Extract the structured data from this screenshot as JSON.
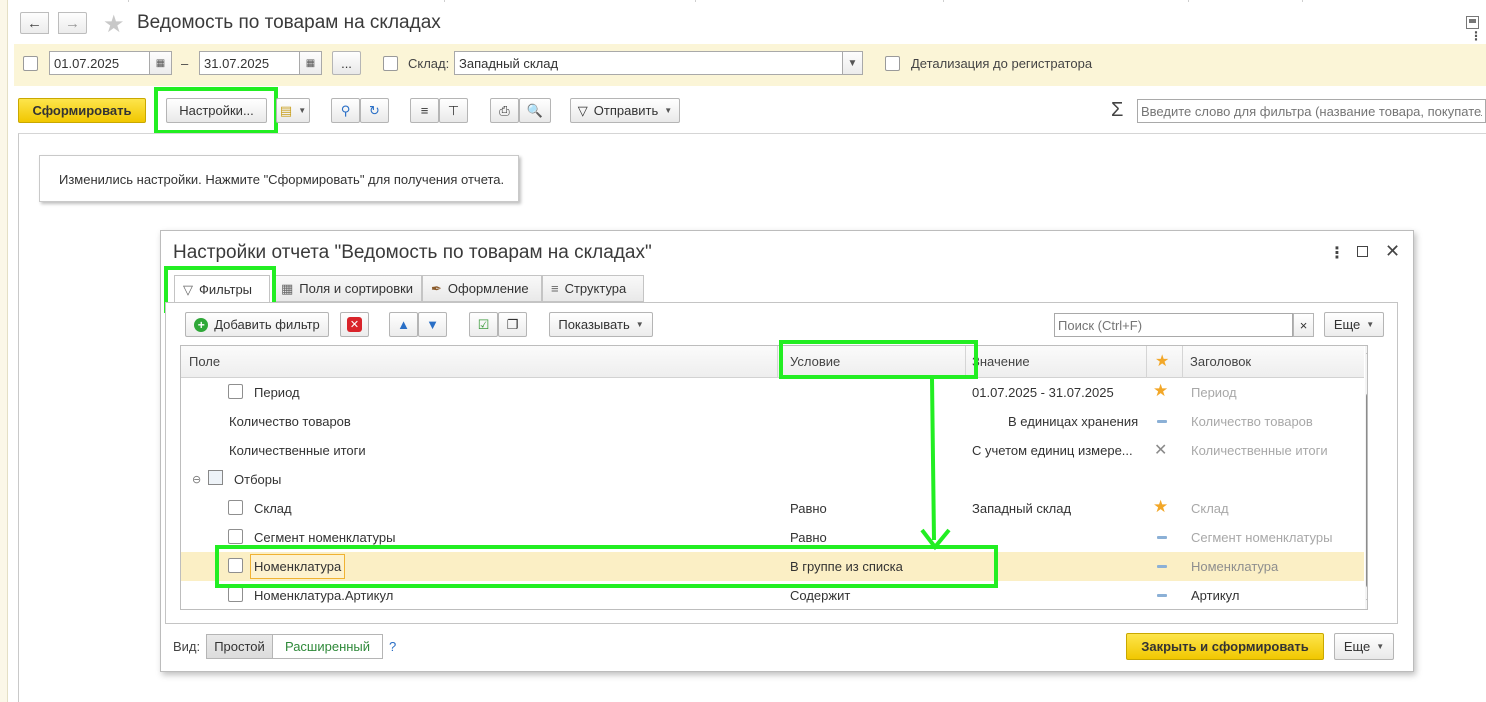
{
  "window": {
    "title": "Ведомость по товарам на складах",
    "back_icon": "arrow-left-icon",
    "forward_icon": "arrow-right-icon",
    "favorite_icon": "star-icon"
  },
  "params": {
    "date_from": "01.07.2025",
    "date_to": "31.07.2025",
    "date_dash": "–",
    "ellipsis_label": "...",
    "warehouse_label": "Склад:",
    "warehouse_value": "Западный склад",
    "detail_label": "Детализация до регистратора"
  },
  "toolbar": {
    "generate_label": "Сформировать",
    "settings_label": "Настройки...",
    "send_label": "Отправить",
    "filter_placeholder": "Введите слово для фильтра (название товара, покупателя",
    "sigma": "Σ"
  },
  "notice": {
    "text": "Изменились настройки. Нажмите \"Сформировать\" для получения отчета."
  },
  "dialog": {
    "title": "Настройки отчета \"Ведомость по товарам на складах\"",
    "tabs": [
      {
        "label": "Фильтры",
        "icon": "funnel-icon"
      },
      {
        "label": "Поля и сортировки",
        "icon": "fields-icon"
      },
      {
        "label": "Оформление",
        "icon": "brush-icon"
      },
      {
        "label": "Структура",
        "icon": "structure-icon"
      }
    ],
    "add_filter_label": "Добавить фильтр",
    "show_label": "Показывать",
    "search_placeholder": "Поиск (Ctrl+F)",
    "search_clear": "×",
    "more_label": "Еще",
    "columns": {
      "field": "Поле",
      "condition": "Условие",
      "value": "Значение",
      "header": "Заголовок"
    },
    "rows": [
      {
        "field": "Период",
        "condition": "",
        "value": "01.07.2025 - 31.07.2025",
        "mark": "star",
        "header": "Период"
      },
      {
        "field": "Количество товаров",
        "condition": "",
        "value": "В единицах хранения",
        "mark": "dash",
        "header": "Количество товаров"
      },
      {
        "field": "Количественные итоги",
        "condition": "",
        "value": "С учетом единиц измере...",
        "mark": "cross",
        "header": "Количественные итоги"
      },
      {
        "field": "Отборы",
        "condition": "",
        "value": "",
        "mark": "",
        "header": ""
      },
      {
        "field": "Склад",
        "condition": "Равно",
        "value": "Западный склад",
        "mark": "star",
        "header": "Склад"
      },
      {
        "field": "Сегмент номенклатуры",
        "condition": "Равно",
        "value": "",
        "mark": "dash",
        "header": "Сегмент номенклатуры"
      },
      {
        "field": "Номенклатура",
        "condition": "В группе из списка",
        "value": "",
        "mark": "dash",
        "header": "Номенклатура"
      },
      {
        "field": "Номенклатура.Артикул",
        "condition": "Содержит",
        "value": "",
        "mark": "dash",
        "header": "Артикул"
      }
    ],
    "view_label": "Вид:",
    "view_simple": "Простой",
    "view_extended": "Расширенный",
    "help": "?",
    "close_generate_label": "Закрыть и сформировать",
    "more_bottom_label": "Еще"
  },
  "colors": {
    "highlight": "#22ee22",
    "accent_yellow": "#f5d20f",
    "selected_row": "#fbefc5",
    "star": "#f2a728"
  }
}
